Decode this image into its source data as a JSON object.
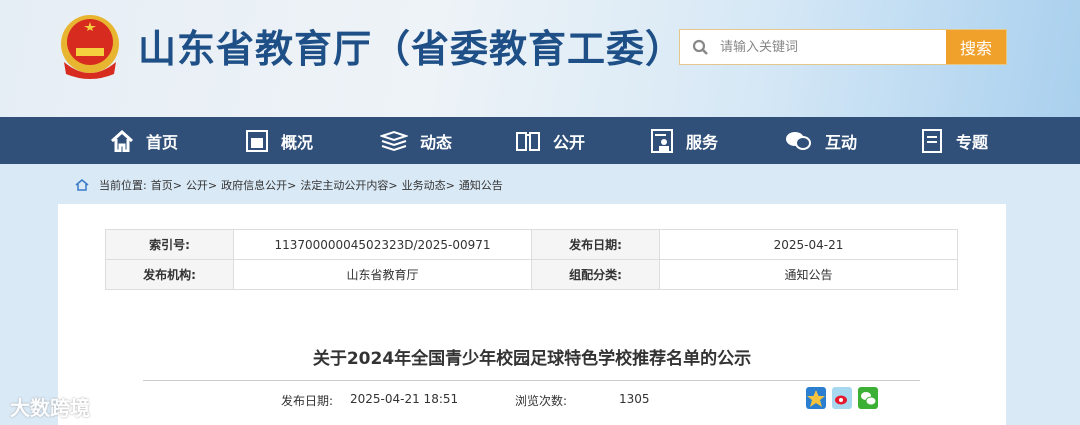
{
  "header": {
    "title": "山东省教育厅（省委教育工委）",
    "search_placeholder": "请输入关键词",
    "search_button": "搜索"
  },
  "nav": [
    {
      "label": "首页",
      "icon": "home-icon"
    },
    {
      "label": "概况",
      "icon": "overview-icon"
    },
    {
      "label": "动态",
      "icon": "news-icon"
    },
    {
      "label": "公开",
      "icon": "book-icon"
    },
    {
      "label": "服务",
      "icon": "service-icon"
    },
    {
      "label": "互动",
      "icon": "chat-icon"
    },
    {
      "label": "专题",
      "icon": "topic-icon"
    }
  ],
  "breadcrumb": {
    "prefix": "当前位置:",
    "items": [
      "首页>",
      "公开>",
      "政府信息公开>",
      "法定主动公开内容>",
      "业务动态>",
      "通知公告"
    ]
  },
  "info": {
    "index_label": "索引号:",
    "index_value": "11370000004502323D/2025-00971",
    "date_label": "发布日期:",
    "date_value": "2025-04-21",
    "org_label": "发布机构:",
    "org_value": "山东省教育厅",
    "category_label": "组配分类:",
    "category_value": "通知公告"
  },
  "article": {
    "title": "关于2024年全国青少年校园足球特色学校推荐名单的公示",
    "date_label": "发布日期:",
    "date_value": "2025-04-21 18:51",
    "views_label": "浏览次数:",
    "views_value": "1305"
  },
  "watermark": "大数跨境"
}
